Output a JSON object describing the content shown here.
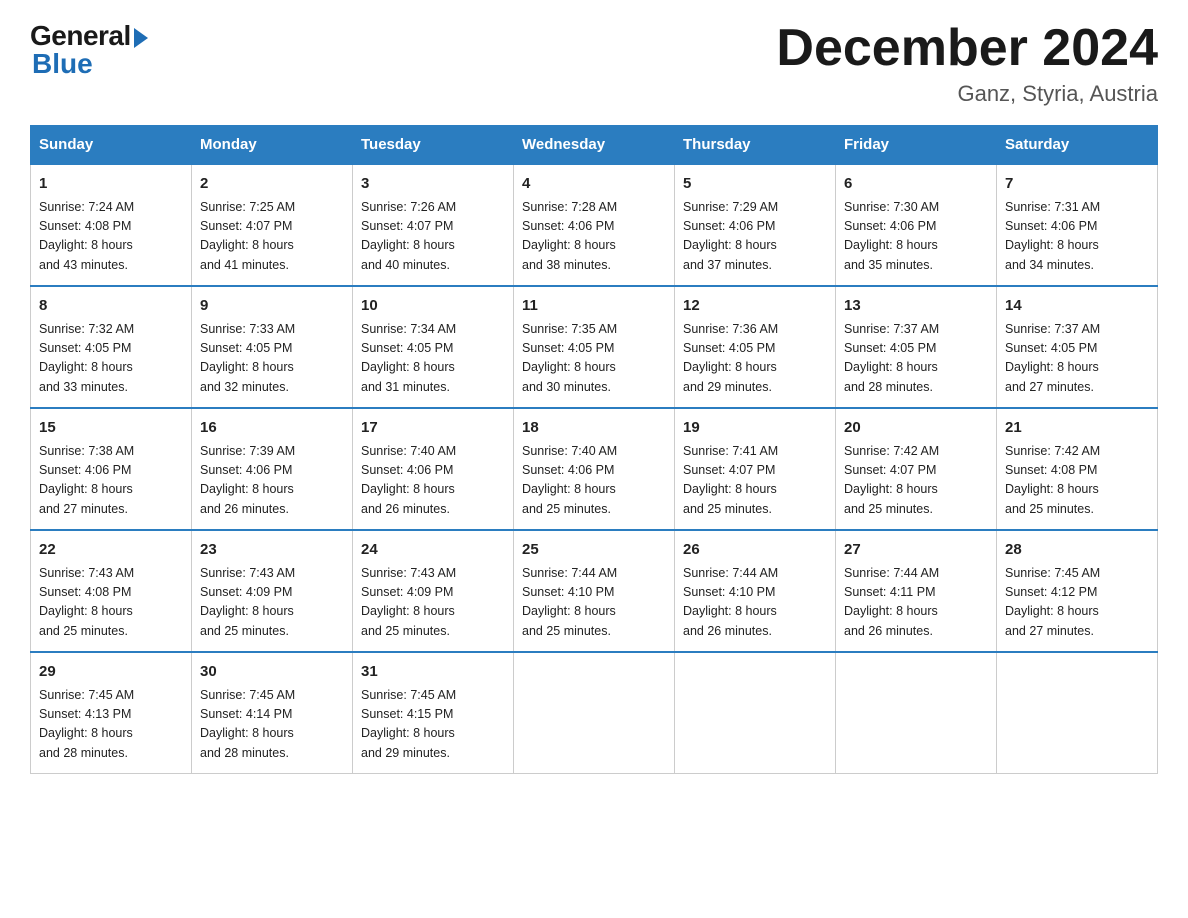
{
  "header": {
    "logo": {
      "general": "General",
      "blue": "Blue"
    },
    "title": "December 2024",
    "location": "Ganz, Styria, Austria"
  },
  "weekdays": [
    "Sunday",
    "Monday",
    "Tuesday",
    "Wednesday",
    "Thursday",
    "Friday",
    "Saturday"
  ],
  "weeks": [
    [
      {
        "day": "1",
        "sunrise": "7:24 AM",
        "sunset": "4:08 PM",
        "daylight": "8 hours and 43 minutes."
      },
      {
        "day": "2",
        "sunrise": "7:25 AM",
        "sunset": "4:07 PM",
        "daylight": "8 hours and 41 minutes."
      },
      {
        "day": "3",
        "sunrise": "7:26 AM",
        "sunset": "4:07 PM",
        "daylight": "8 hours and 40 minutes."
      },
      {
        "day": "4",
        "sunrise": "7:28 AM",
        "sunset": "4:06 PM",
        "daylight": "8 hours and 38 minutes."
      },
      {
        "day": "5",
        "sunrise": "7:29 AM",
        "sunset": "4:06 PM",
        "daylight": "8 hours and 37 minutes."
      },
      {
        "day": "6",
        "sunrise": "7:30 AM",
        "sunset": "4:06 PM",
        "daylight": "8 hours and 35 minutes."
      },
      {
        "day": "7",
        "sunrise": "7:31 AM",
        "sunset": "4:06 PM",
        "daylight": "8 hours and 34 minutes."
      }
    ],
    [
      {
        "day": "8",
        "sunrise": "7:32 AM",
        "sunset": "4:05 PM",
        "daylight": "8 hours and 33 minutes."
      },
      {
        "day": "9",
        "sunrise": "7:33 AM",
        "sunset": "4:05 PM",
        "daylight": "8 hours and 32 minutes."
      },
      {
        "day": "10",
        "sunrise": "7:34 AM",
        "sunset": "4:05 PM",
        "daylight": "8 hours and 31 minutes."
      },
      {
        "day": "11",
        "sunrise": "7:35 AM",
        "sunset": "4:05 PM",
        "daylight": "8 hours and 30 minutes."
      },
      {
        "day": "12",
        "sunrise": "7:36 AM",
        "sunset": "4:05 PM",
        "daylight": "8 hours and 29 minutes."
      },
      {
        "day": "13",
        "sunrise": "7:37 AM",
        "sunset": "4:05 PM",
        "daylight": "8 hours and 28 minutes."
      },
      {
        "day": "14",
        "sunrise": "7:37 AM",
        "sunset": "4:05 PM",
        "daylight": "8 hours and 27 minutes."
      }
    ],
    [
      {
        "day": "15",
        "sunrise": "7:38 AM",
        "sunset": "4:06 PM",
        "daylight": "8 hours and 27 minutes."
      },
      {
        "day": "16",
        "sunrise": "7:39 AM",
        "sunset": "4:06 PM",
        "daylight": "8 hours and 26 minutes."
      },
      {
        "day": "17",
        "sunrise": "7:40 AM",
        "sunset": "4:06 PM",
        "daylight": "8 hours and 26 minutes."
      },
      {
        "day": "18",
        "sunrise": "7:40 AM",
        "sunset": "4:06 PM",
        "daylight": "8 hours and 25 minutes."
      },
      {
        "day": "19",
        "sunrise": "7:41 AM",
        "sunset": "4:07 PM",
        "daylight": "8 hours and 25 minutes."
      },
      {
        "day": "20",
        "sunrise": "7:42 AM",
        "sunset": "4:07 PM",
        "daylight": "8 hours and 25 minutes."
      },
      {
        "day": "21",
        "sunrise": "7:42 AM",
        "sunset": "4:08 PM",
        "daylight": "8 hours and 25 minutes."
      }
    ],
    [
      {
        "day": "22",
        "sunrise": "7:43 AM",
        "sunset": "4:08 PM",
        "daylight": "8 hours and 25 minutes."
      },
      {
        "day": "23",
        "sunrise": "7:43 AM",
        "sunset": "4:09 PM",
        "daylight": "8 hours and 25 minutes."
      },
      {
        "day": "24",
        "sunrise": "7:43 AM",
        "sunset": "4:09 PM",
        "daylight": "8 hours and 25 minutes."
      },
      {
        "day": "25",
        "sunrise": "7:44 AM",
        "sunset": "4:10 PM",
        "daylight": "8 hours and 25 minutes."
      },
      {
        "day": "26",
        "sunrise": "7:44 AM",
        "sunset": "4:10 PM",
        "daylight": "8 hours and 26 minutes."
      },
      {
        "day": "27",
        "sunrise": "7:44 AM",
        "sunset": "4:11 PM",
        "daylight": "8 hours and 26 minutes."
      },
      {
        "day": "28",
        "sunrise": "7:45 AM",
        "sunset": "4:12 PM",
        "daylight": "8 hours and 27 minutes."
      }
    ],
    [
      {
        "day": "29",
        "sunrise": "7:45 AM",
        "sunset": "4:13 PM",
        "daylight": "8 hours and 28 minutes."
      },
      {
        "day": "30",
        "sunrise": "7:45 AM",
        "sunset": "4:14 PM",
        "daylight": "8 hours and 28 minutes."
      },
      {
        "day": "31",
        "sunrise": "7:45 AM",
        "sunset": "4:15 PM",
        "daylight": "8 hours and 29 minutes."
      },
      null,
      null,
      null,
      null
    ]
  ],
  "labels": {
    "sunrise": "Sunrise:",
    "sunset": "Sunset:",
    "daylight": "Daylight:"
  }
}
